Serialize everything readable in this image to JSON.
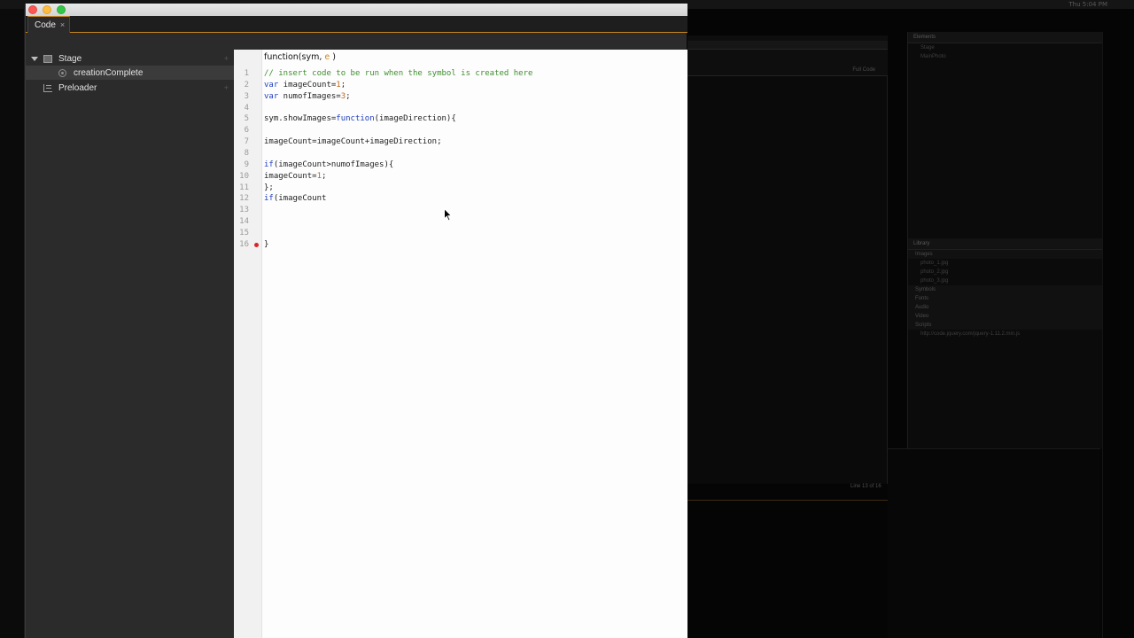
{
  "window": {
    "tab_label": "Code",
    "tab_close": "×"
  },
  "tree": {
    "items": [
      {
        "label": "Stage",
        "icon": "stage-icon"
      },
      {
        "label": "creationComplete",
        "icon": "event-icon"
      },
      {
        "label": "Preloader",
        "icon": "preloader-icon"
      }
    ]
  },
  "editor": {
    "header_prefix": "function(sym, ",
    "header_param": "e",
    "header_suffix": " )",
    "lines": [
      {
        "n": "1",
        "text": "// insert code to be run when the symbol is created here"
      },
      {
        "n": "2",
        "text": "var imageCount=1;"
      },
      {
        "n": "3",
        "text": "var numofImages=3;"
      },
      {
        "n": "4",
        "text": ""
      },
      {
        "n": "5",
        "text": "sym.showImages=function(imageDirection){"
      },
      {
        "n": "6",
        "text": ""
      },
      {
        "n": "7",
        "text": "imageCount=imageCount+imageDirection;"
      },
      {
        "n": "8",
        "text": ""
      },
      {
        "n": "9",
        "text": "if(imageCount>numofImages){"
      },
      {
        "n": "10",
        "text": "imageCount=1;"
      },
      {
        "n": "11",
        "text": "};"
      },
      {
        "n": "12",
        "text": "if(imageCount"
      },
      {
        "n": "13",
        "text": ""
      },
      {
        "n": "14",
        "text": ""
      },
      {
        "n": "15",
        "text": ""
      },
      {
        "n": "16",
        "text": "}"
      }
    ],
    "breakpoint_line": "16"
  },
  "background": {
    "clock": "Thu 5:04 PM",
    "full_code": "Full Code",
    "line_of": "Line 13 of 16",
    "library_title": "Library",
    "elements_title": "Elements",
    "library_sections": [
      "Images",
      "Symbols",
      "Fonts",
      "Audio",
      "Video",
      "Scripts"
    ],
    "library_images": [
      "photo_1.jpg",
      "photo_2.jpg",
      "photo_3.jpg"
    ],
    "library_script": "http://code.jquery.com/jquery-1.11.2.min.js",
    "elements_items": [
      "Stage",
      "MainPhoto"
    ]
  },
  "colors": {
    "accent": "#c8871e",
    "comment": "#3f8f2e",
    "keyword": "#1f3fbf",
    "number": "#c0651a",
    "breakpoint": "#d9242a"
  }
}
